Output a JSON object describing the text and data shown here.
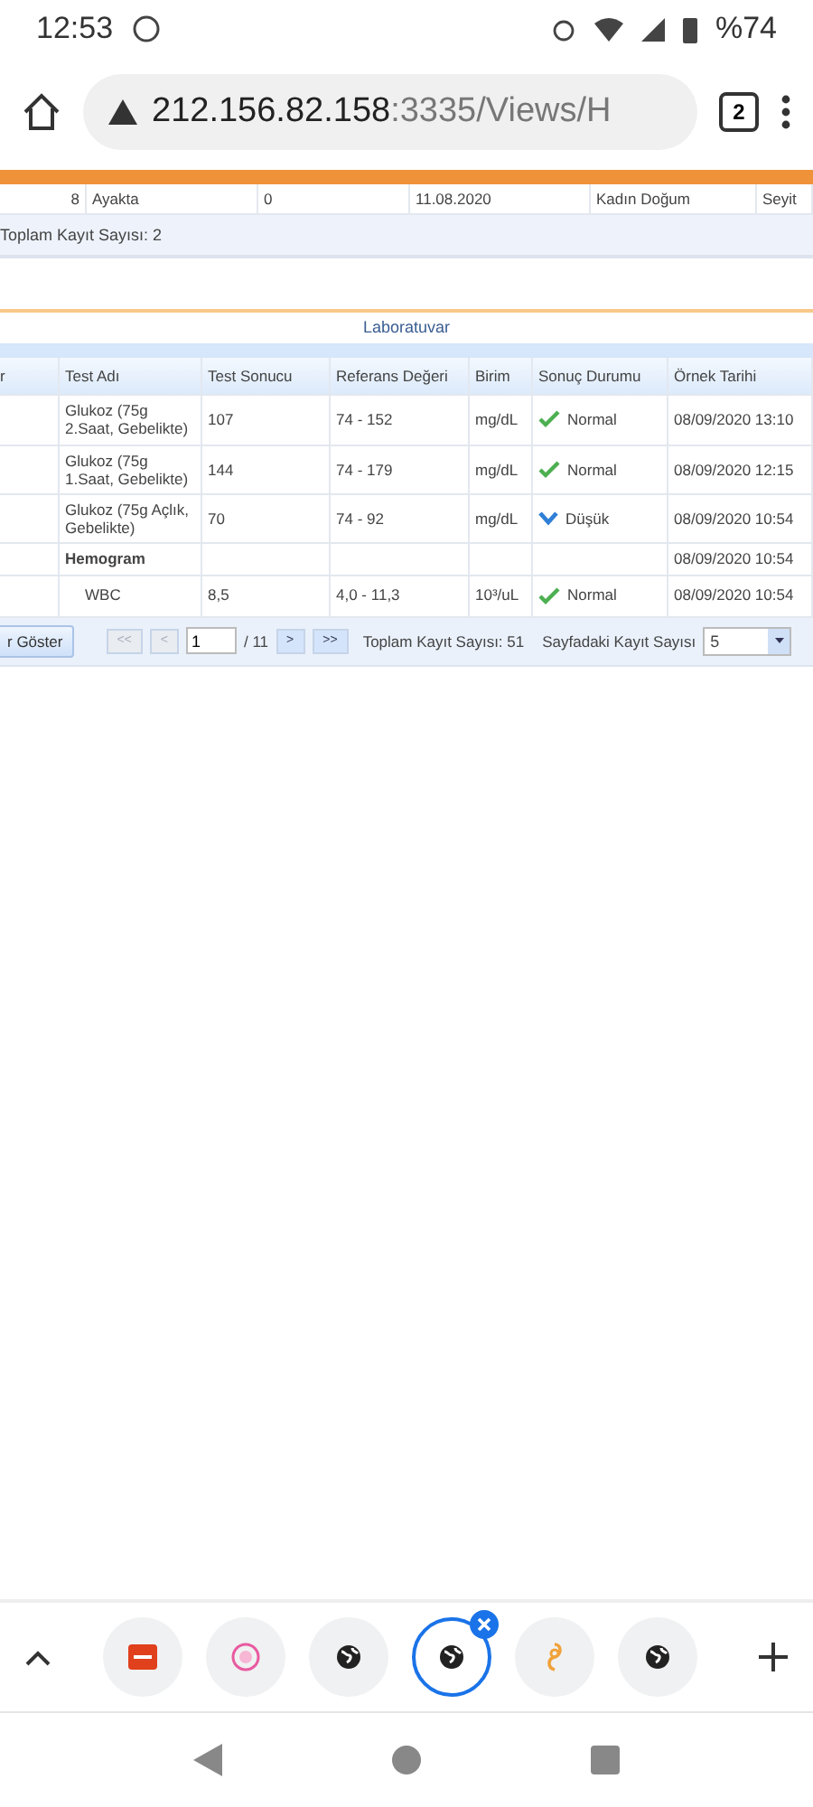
{
  "status_bar": {
    "time": "12:53",
    "battery": "%74"
  },
  "browser": {
    "url_host": "212.156.82.158",
    "url_rest": ":3335/Views/H",
    "tab_count": "2"
  },
  "visits": {
    "rows": [
      {
        "no": "8",
        "type": "Ayakta",
        "count": "0",
        "date": "11.08.2020",
        "department": "Kadın Doğum",
        "doctor": "Seyit"
      }
    ],
    "total": "Toplam Kayıt Sayısı: 2"
  },
  "lab": {
    "title": "Laboratuvar",
    "columns": [
      "r",
      "Test Adı",
      "Test Sonucu",
      "Referans Değeri",
      "Birim",
      "Sonuç Durumu",
      "Örnek Tarihi"
    ],
    "rows": [
      {
        "kind": "test",
        "name": "Glukoz (75g 2.Saat, Gebelikte)",
        "result": "107",
        "reference": "74 - 152",
        "unit": "mg/dL",
        "status": {
          "kind": "normal",
          "text": "Normal"
        },
        "date": "08/09/2020 13:10"
      },
      {
        "kind": "test",
        "name": "Glukoz (75g 1.Saat, Gebelikte)",
        "result": "144",
        "reference": "74 - 179",
        "unit": "mg/dL",
        "status": {
          "kind": "normal",
          "text": "Normal"
        },
        "date": "08/09/2020 12:15"
      },
      {
        "kind": "test",
        "name": "Glukoz (75g Açlık, Gebelikte)",
        "result": "70",
        "reference": "74 - 92",
        "unit": "mg/dL",
        "status": {
          "kind": "low",
          "text": "Düşük"
        },
        "date": "08/09/2020 10:54"
      },
      {
        "kind": "group",
        "name": "Hemogram",
        "date": "08/09/2020 10:54"
      },
      {
        "kind": "subtest",
        "name": "WBC",
        "result": "8,5",
        "reference": "4,0 - 11,3",
        "unit": "10³/uL",
        "status": {
          "kind": "normal",
          "text": "Normal"
        },
        "date": "08/09/2020 10:54"
      }
    ],
    "pager": {
      "show_button": "r Göster",
      "buttons": [
        {
          "label": "<<",
          "disabled": true
        },
        {
          "label": "<",
          "disabled": true
        }
      ],
      "page": "1",
      "pages": "/ 11",
      "next_buttons": [
        {
          "label": ">",
          "disabled": false
        },
        {
          "label": ">>",
          "disabled": false
        }
      ],
      "total": "Toplam Kayıt Sayısı: 51",
      "page_size_label": "Sayfadaki Kayıt Sayısı",
      "page_size": "5"
    }
  },
  "tabs": [
    {
      "kind": "redlogo",
      "selected": false
    },
    {
      "kind": "pinklogo",
      "selected": false
    },
    {
      "kind": "globe",
      "selected": false
    },
    {
      "kind": "globe",
      "selected": true
    },
    {
      "kind": "orangelogo",
      "selected": false
    },
    {
      "kind": "globe",
      "selected": false
    }
  ]
}
